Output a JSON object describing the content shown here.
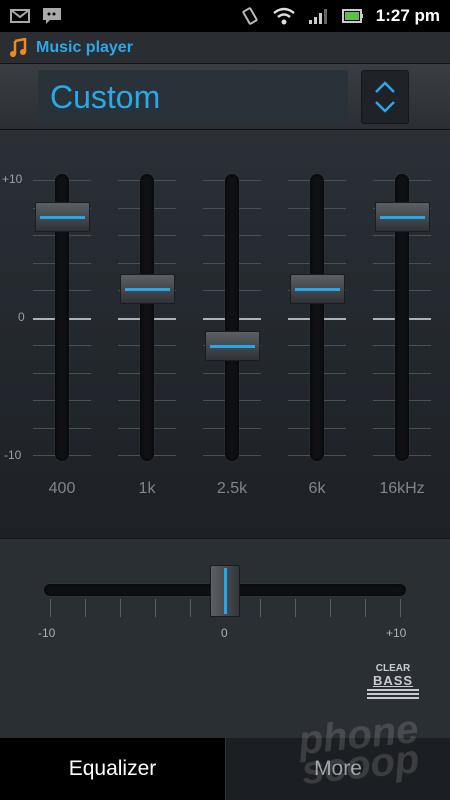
{
  "status_bar": {
    "time": "1:27 pm",
    "icons": [
      "gmail-icon",
      "messaging-icon",
      "vibrate-icon",
      "wifi-icon",
      "signal-icon",
      "battery-charging-icon"
    ]
  },
  "app": {
    "title": "Music player",
    "icon": "music-note-icon"
  },
  "preset": {
    "value": "Custom",
    "spinner_icon": "up-down-chevron-icon"
  },
  "equalizer": {
    "scale": {
      "max_label": "+10",
      "mid_label": "0",
      "min_label": "-10",
      "max": 10,
      "min": -10
    },
    "bands": [
      {
        "label": "400",
        "value": 7
      },
      {
        "label": "1k",
        "value": 2
      },
      {
        "label": "2.5k",
        "value": -2
      },
      {
        "label": "6k",
        "value": 2
      },
      {
        "label": "16kHz",
        "value": 7
      }
    ]
  },
  "clear_bass": {
    "min_label": "-10",
    "mid_label": "0",
    "max_label": "+10",
    "value": 0,
    "logo_top": "CLEAR",
    "logo_bottom": "BASS"
  },
  "tabs": [
    {
      "label": "Equalizer",
      "active": true
    },
    {
      "label": "More",
      "active": false
    }
  ],
  "watermark": {
    "line1": "phone",
    "line2": "scoop"
  },
  "colors": {
    "accent": "#25a7ea",
    "title": "#2aa8e8"
  }
}
